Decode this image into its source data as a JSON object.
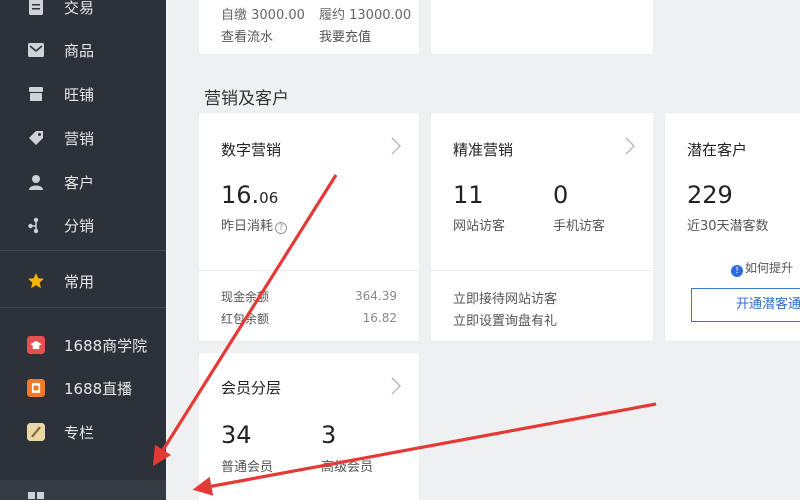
{
  "sidebar": {
    "items": [
      {
        "label": "交易",
        "icon": "document-icon"
      },
      {
        "label": "商品",
        "icon": "envelope-icon"
      },
      {
        "label": "旺铺",
        "icon": "store-icon"
      },
      {
        "label": "营销",
        "icon": "tag-icon"
      },
      {
        "label": "客户",
        "icon": "user-icon"
      },
      {
        "label": "分销",
        "icon": "share-icon"
      },
      {
        "label": "常用",
        "icon": "star-icon"
      },
      {
        "label": "1688商学院",
        "icon": "academy-icon"
      },
      {
        "label": "1688直播",
        "icon": "live-icon"
      },
      {
        "label": "专栏",
        "icon": "column-icon"
      }
    ],
    "colors": {
      "star": "#f5b400",
      "academy": "#e84f4f",
      "live": "#f07a2a",
      "column": "#e9d7a6"
    }
  },
  "top_cards": {
    "left": {
      "left_amount": "自缴 3000.00",
      "right_amount": "履约 13000.00",
      "left_link": "查看流水",
      "right_link": "我要充值"
    }
  },
  "section_title": "营销及客户",
  "cards": {
    "digital": {
      "title": "数字营销",
      "value_main": "16.",
      "value_frac": "06",
      "value_label": "昨日消耗",
      "help": "?",
      "rows": [
        {
          "label": "现金余额",
          "value": "364.39"
        },
        {
          "label": "红包余额",
          "value": "16.82"
        }
      ]
    },
    "precise": {
      "title": "精准营销",
      "stat1_value": "11",
      "stat1_label": "网站访客",
      "stat2_value": "0",
      "stat2_label": "手机访客",
      "link1": "立即接待网站访客",
      "link2": "立即设置询盘有礼"
    },
    "potential": {
      "title": "潜在客户",
      "value": "229",
      "label": "近30天潜客数",
      "info_text": "如何提升",
      "button_label": "开通潜客通"
    },
    "member": {
      "title": "会员分层",
      "stat1_value": "34",
      "stat1_label": "普通会员",
      "stat2_value": "3",
      "stat2_label": "高级会员"
    }
  },
  "accent": "#2c6ccf",
  "arrow_color": "#e53935"
}
